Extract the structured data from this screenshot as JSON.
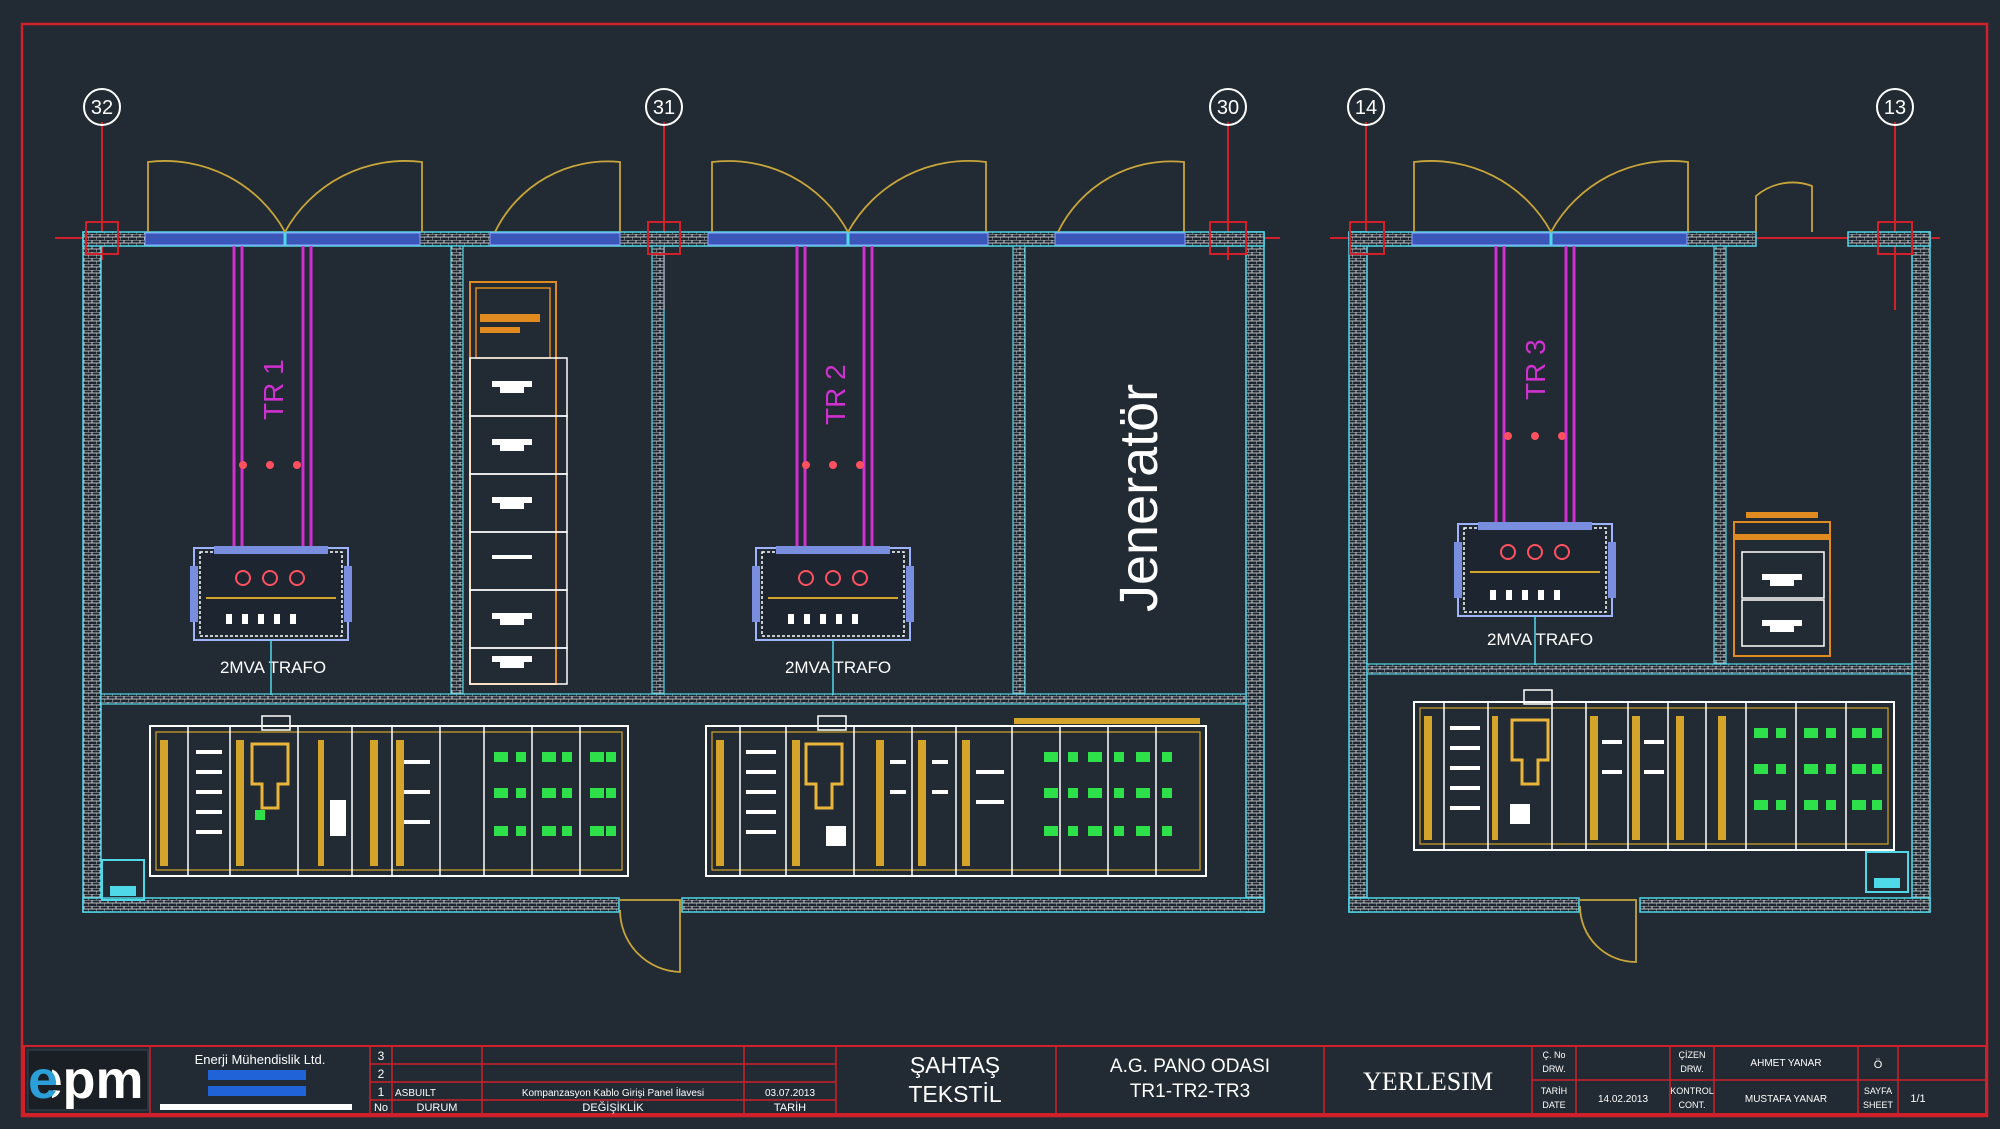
{
  "grid_markers": [
    "32",
    "31",
    "30",
    "14",
    "13"
  ],
  "rooms": {
    "tr1_label": "TR 1",
    "tr2_label": "TR 2",
    "tr3_label": "TR 3",
    "trafo_caption": "2MVA TRAFO",
    "generator_label": "Jeneratör"
  },
  "title_block": {
    "logo": "epm",
    "company": "Enerji Mühendislik Ltd.",
    "rev_numbers": [
      "3",
      "2",
      "1"
    ],
    "rev1_status": "ASBUILT",
    "rev1_desc": "Kompanzasyon Kablo Girişi Panel İlavesi",
    "rev1_date": "03.07.2013",
    "col_no": "No",
    "col_status": "DURUM",
    "col_changes": "DEĞİŞİKLİK",
    "col_date": "TARİH",
    "client_line1": "ŞAHTAŞ",
    "client_line2": "TEKSTİL",
    "project_line1": "A.G. PANO ODASI",
    "project_line2": "TR1-TR2-TR3",
    "drawing_title": "YERLESIM",
    "lbl_drawing_no": "Ç. No",
    "lbl_drawn": "ÇİZEN",
    "lbl_drawn_en": "DRW.",
    "lbl_date": "TARİH",
    "lbl_date_en": "DATE",
    "date_value": "14.02.2013",
    "lbl_control": "KONTROL",
    "lbl_control_en": "CONT.",
    "drawn_by": "AHMET YANAR",
    "checked_by": "MUSTAFA YANAR",
    "lbl_scale": "Ö",
    "lbl_sheet": "SAYFA",
    "lbl_sheet_en": "SHEET",
    "sheet_value": "1/1"
  }
}
